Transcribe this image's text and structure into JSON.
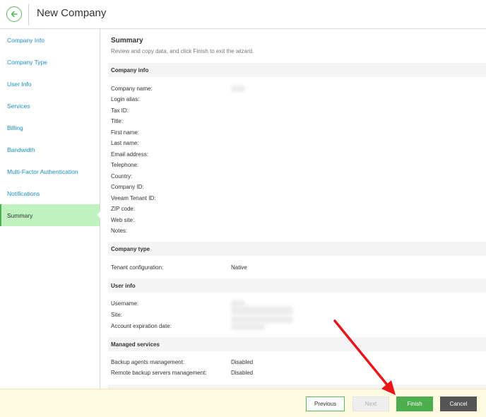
{
  "header": {
    "title": "New Company"
  },
  "sidebar": {
    "items": [
      {
        "label": "Company Info"
      },
      {
        "label": "Company Type"
      },
      {
        "label": "User Info"
      },
      {
        "label": "Services"
      },
      {
        "label": "Billing"
      },
      {
        "label": "Bandwidth"
      },
      {
        "label": "Multi-Factor Authentication"
      },
      {
        "label": "Notifications"
      },
      {
        "label": "Summary",
        "active": true
      }
    ]
  },
  "summary": {
    "title": "Summary",
    "description": "Review and copy data, and click Finish to exit the wizard."
  },
  "company_info": {
    "heading": "Company info",
    "labels": [
      "Company name:",
      "Login alias:",
      "Tax ID:",
      "Title:",
      "First name:",
      "Last name:",
      "Email address:",
      "Telephone:",
      "Country:",
      "Company ID:",
      "Veeam Tenant ID:",
      "ZIP code:",
      "Web site:",
      "Notes:"
    ]
  },
  "company_type": {
    "heading": "Company type",
    "label": "Tenant configuration:",
    "value": "Native"
  },
  "user_info": {
    "heading": "User info",
    "labels": [
      "Username:",
      "Site:",
      "Account expiration date:"
    ]
  },
  "managed_services": {
    "heading": "Managed services",
    "rows": [
      {
        "label": "Backup agents management:",
        "value": "Disabled"
      },
      {
        "label": "Remote backup servers management:",
        "value": "Disabled"
      }
    ]
  },
  "footer": {
    "previous": "Previous",
    "next": "Next",
    "finish": "Finish",
    "cancel": "Cancel"
  },
  "colors": {
    "accent_green": "#4cae4c",
    "link_blue": "#1a8fc4",
    "active_nav_bg": "#bff2bf",
    "footer_bg": "#fffbe0",
    "annotation_arrow": "#e8151b"
  },
  "icons": {
    "back": "arrow-left-circle-icon"
  }
}
